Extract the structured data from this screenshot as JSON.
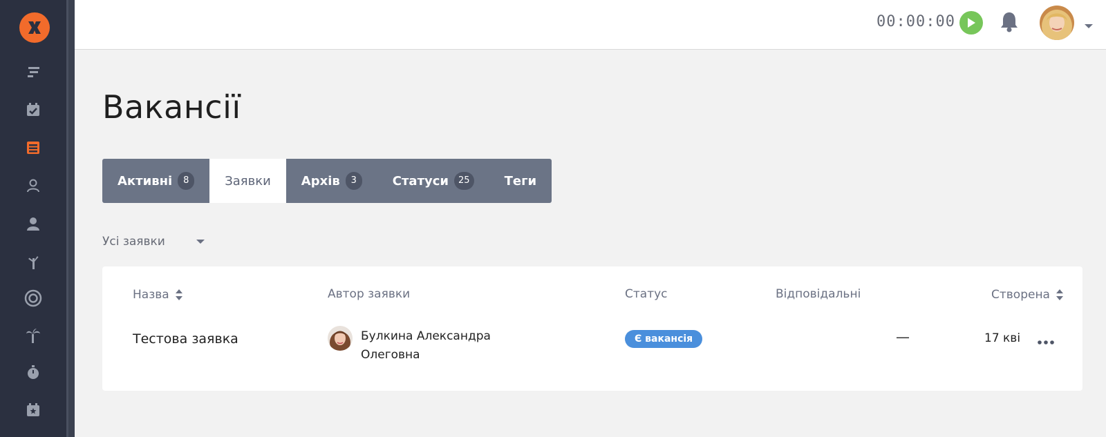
{
  "topbar": {
    "timer": "00:00:00"
  },
  "page": {
    "title": "Вакансії"
  },
  "tabs": [
    {
      "label": "Активні",
      "badge": "8"
    },
    {
      "label": "Заявки",
      "badge": ""
    },
    {
      "label": "Архів",
      "badge": "3"
    },
    {
      "label": "Статуси",
      "badge": "25"
    },
    {
      "label": "Теги",
      "badge": ""
    }
  ],
  "filter": {
    "selected": "Усі заявки"
  },
  "table": {
    "headers": {
      "name": "Назва",
      "author": "Автор заявки",
      "status": "Статус",
      "responsible": "Відповідальні",
      "created": "Створена"
    },
    "rows": [
      {
        "title": "Тестова заявка",
        "author": "Булкина Александра Олеговна",
        "status": "Є вакансія",
        "responsible": "—",
        "created": "17 кві"
      }
    ]
  },
  "colors": {
    "sidebar": "#2b3040",
    "accent": "#f26b2b",
    "tab_bar": "#6b7486",
    "status_badge": "#4a8fdc",
    "play": "#77c65a"
  }
}
